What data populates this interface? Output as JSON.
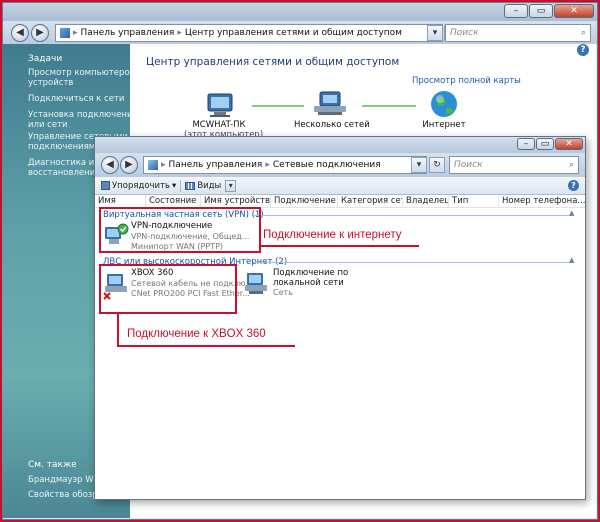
{
  "back_window": {
    "breadcrumb": [
      "Панель управления",
      "Центр управления сетями и общим доступом"
    ],
    "search_placeholder": "Поиск",
    "window_buttons": {
      "minimize": "–",
      "maximize": "▭",
      "close": "✕"
    },
    "left_pane": {
      "heading": "Задачи",
      "tasks": [
        "Просмотр компьютеров и устройств",
        "Подключиться к сети",
        "Установка подключения или сети",
        "Управление сетевыми подключениями",
        "Диагностика и восстановление"
      ],
      "see_also": [
        "См. также",
        "Брандмауэр Windows",
        "Свойства обозревателя"
      ]
    },
    "main": {
      "title": "Центр управления сетями и общим доступом",
      "map_link": "Просмотр полной карты",
      "nodes": [
        {
          "label": "MCWHAT-ПК",
          "sub": "(этот компьютер)"
        },
        {
          "label": "Несколько сетей"
        },
        {
          "label": "Интернет"
        }
      ]
    }
  },
  "front_window": {
    "breadcrumb": [
      "Панель управления",
      "Сетевые подключения"
    ],
    "search_placeholder": "Поиск",
    "toolbar": {
      "organize_label": "Упорядочить",
      "views_label": "Виды"
    },
    "columns": [
      "Имя",
      "Состояние",
      "Имя устройства",
      "Подключение",
      "Категория сети",
      "Владелец",
      "Тип",
      "Номер телефона..."
    ],
    "groups": [
      {
        "title": "Виртуальная частная сеть (VPN) (1)",
        "items": [
          {
            "name": "VPN-подключение",
            "status": "VPN-подключение, Общед...",
            "device": "Минипорт WAN (PPTP)"
          }
        ]
      },
      {
        "title": "ЛВС или высокоскоростной Интернет (2)",
        "items": [
          {
            "name": "XBOX 360",
            "status": "Сетевой кабель не подклю...",
            "device": "CNet PRO200 PCI Fast Ether..."
          },
          {
            "name": "Подключение по локальной сети",
            "status": "Сеть",
            "device": ""
          }
        ]
      }
    ]
  },
  "annotations": {
    "internet_label": "Подключение к интернету",
    "xbox_label": "Подключение к XBOX 360",
    "color": "#c8102e"
  }
}
